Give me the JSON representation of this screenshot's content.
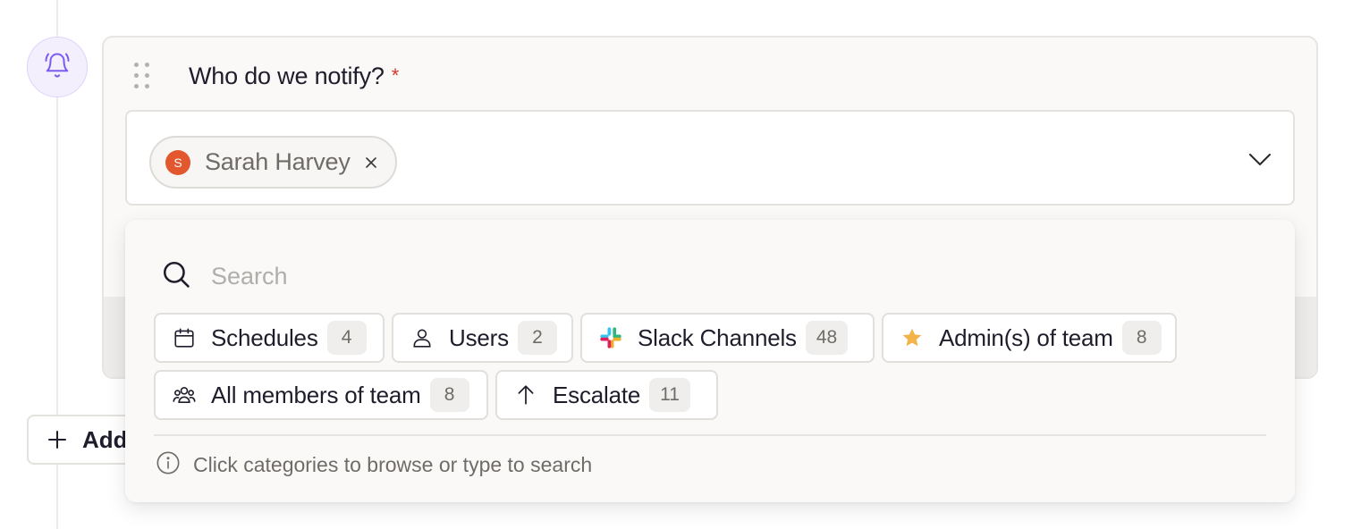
{
  "step": {
    "icon": "bell-icon",
    "accent_color": "#7c5cf0",
    "question": "Who do we notify?",
    "required_marker": "*"
  },
  "selection": {
    "chips": [
      {
        "avatar_initial": "S",
        "name": "Sarah Harvey",
        "avatar_color": "#e2572e"
      }
    ]
  },
  "add_button": {
    "label": "Add"
  },
  "popover": {
    "search_placeholder": "Search",
    "categories": [
      {
        "label": "Schedules",
        "count": "4",
        "icon": "calendar-icon"
      },
      {
        "label": "Users",
        "count": "2",
        "icon": "user-icon"
      },
      {
        "label": "Slack Channels",
        "count": "48",
        "icon": "slack-icon"
      },
      {
        "label": "Admin(s) of team",
        "count": "8",
        "icon": "star-icon"
      },
      {
        "label": "All members of team",
        "count": "8",
        "icon": "team-icon"
      },
      {
        "label": "Escalate",
        "count": "11",
        "icon": "arrow-up-icon"
      }
    ],
    "hint": "Click categories to browse or type to search"
  }
}
